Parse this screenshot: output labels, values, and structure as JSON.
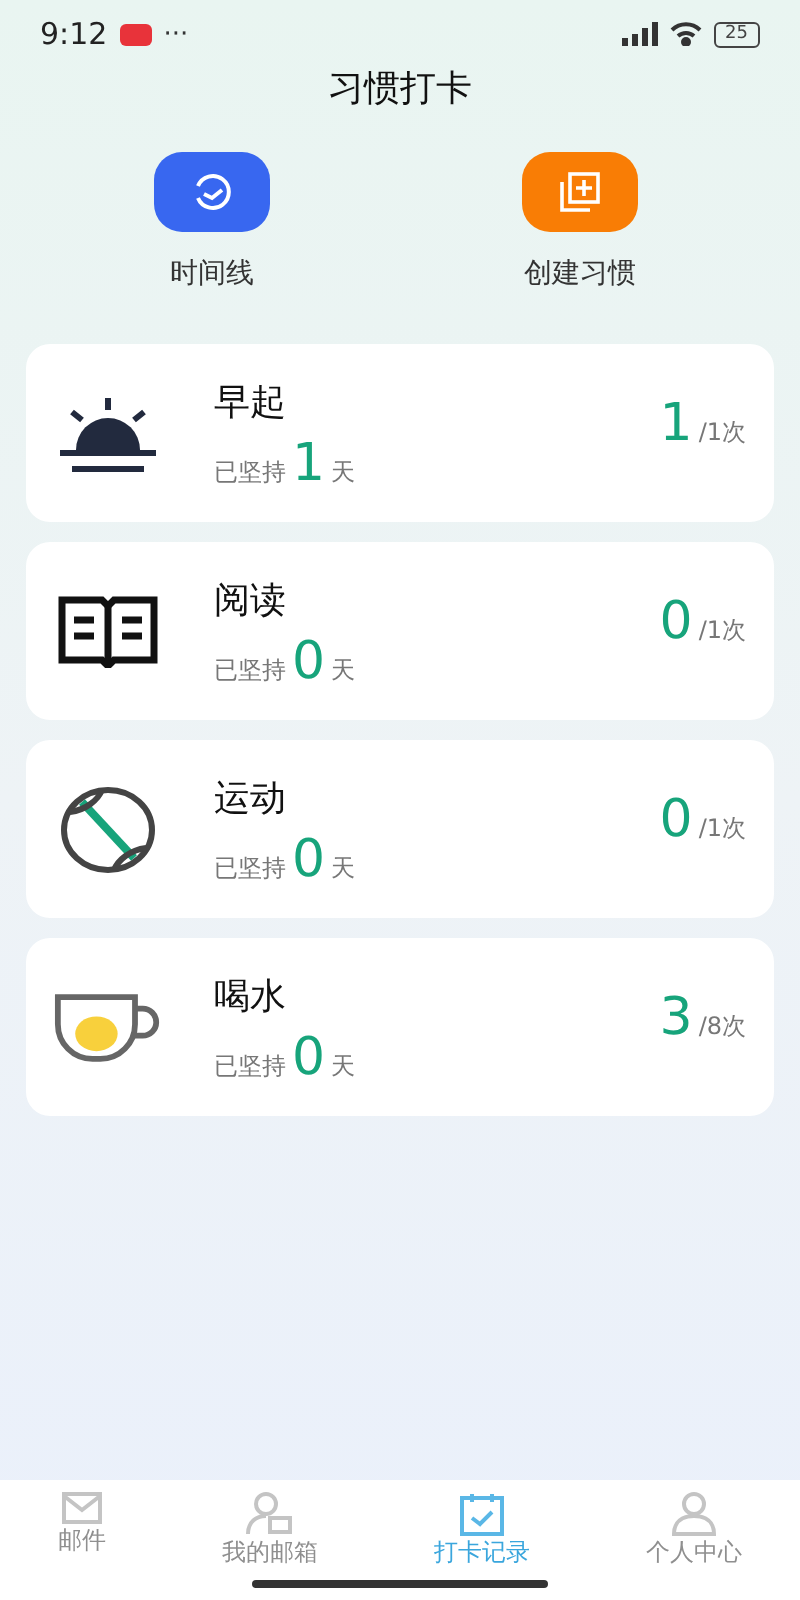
{
  "status_bar": {
    "time": "9:12",
    "dots": "···",
    "battery": "25"
  },
  "title": "习惯打卡",
  "actions": [
    {
      "kind": "timeline",
      "label": "时间线"
    },
    {
      "kind": "create",
      "label": "创建习惯"
    }
  ],
  "habits": [
    {
      "kind": "sun",
      "name": "早起",
      "streak_prefix": "已坚持",
      "streak": "1",
      "streak_unit": "天",
      "done": "1",
      "target": "/1次"
    },
    {
      "kind": "book",
      "name": "阅读",
      "streak_prefix": "已坚持",
      "streak": "0",
      "streak_unit": "天",
      "done": "0",
      "target": "/1次"
    },
    {
      "kind": "ball",
      "name": "运动",
      "streak_prefix": "已坚持",
      "streak": "0",
      "streak_unit": "天",
      "done": "0",
      "target": "/1次"
    },
    {
      "kind": "cup",
      "name": "喝水",
      "streak_prefix": "已坚持",
      "streak": "0",
      "streak_unit": "天",
      "done": "3",
      "target": "/8次"
    }
  ],
  "tabs": [
    {
      "kind": "mail",
      "label": "邮件",
      "selected": false
    },
    {
      "kind": "mailbox",
      "label": "我的邮箱",
      "selected": false
    },
    {
      "kind": "checkin",
      "label": "打卡记录",
      "selected": true
    },
    {
      "kind": "person",
      "label": "个人中心",
      "selected": false
    }
  ]
}
